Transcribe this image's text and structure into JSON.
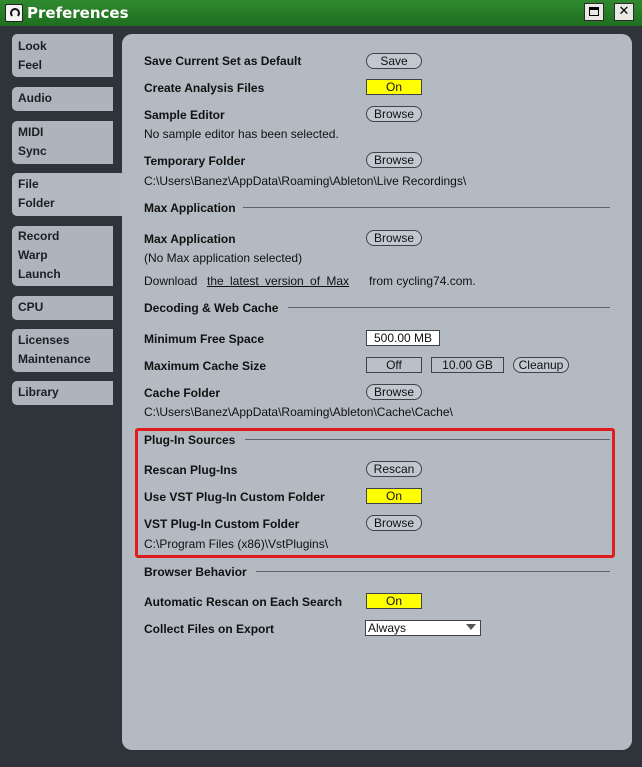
{
  "window": {
    "title": "Preferences"
  },
  "sidebar": {
    "tabs": [
      {
        "lines": [
          "Look",
          "Feel"
        ]
      },
      {
        "lines": [
          "Audio"
        ]
      },
      {
        "lines": [
          "MIDI",
          "Sync"
        ]
      },
      {
        "lines": [
          "File",
          "Folder"
        ],
        "active": true
      },
      {
        "lines": [
          "Record",
          "Warp",
          "Launch"
        ]
      },
      {
        "lines": [
          "CPU"
        ]
      },
      {
        "lines": [
          "Licenses",
          "Maintenance"
        ]
      },
      {
        "lines": [
          "Library"
        ]
      }
    ]
  },
  "panel": {
    "save_current_set": {
      "label": "Save Current Set as Default",
      "button": "Save"
    },
    "create_analysis_files": {
      "label": "Create Analysis Files",
      "value": "On"
    },
    "sample_editor": {
      "label": "Sample Editor",
      "button": "Browse",
      "status": "No sample editor has been selected."
    },
    "temporary_folder": {
      "label": "Temporary Folder",
      "button": "Browse",
      "path": "C:\\Users\\Banez\\AppData\\Roaming\\Ableton\\Live Recordings\\"
    },
    "max_section": "Max Application",
    "max_application": {
      "label": "Max Application",
      "button": "Browse",
      "status": "(No Max application selected)"
    },
    "download_max": {
      "prefix": "Download",
      "link": "the latest version of Max",
      "suffix": "from cycling74.com."
    },
    "cache_section": "Decoding & Web Cache",
    "min_free_space": {
      "label": "Minimum Free Space",
      "value": "500.00 MB"
    },
    "max_cache_size": {
      "label": "Maximum Cache Size",
      "toggle": "Off",
      "value": "10.00 GB",
      "cleanup": "Cleanup"
    },
    "cache_folder": {
      "label": "Cache Folder",
      "button": "Browse",
      "path": "C:\\Users\\Banez\\AppData\\Roaming\\Ableton\\Cache\\Cache\\"
    },
    "plugin_section": "Plug-In Sources",
    "rescan_plugins": {
      "label": "Rescan Plug-Ins",
      "button": "Rescan"
    },
    "use_vst_custom_folder": {
      "label": "Use VST Plug-In Custom Folder",
      "value": "On"
    },
    "vst_custom_folder": {
      "label": "VST Plug-In Custom Folder",
      "button": "Browse",
      "path": "C:\\Program Files (x86)\\VstPlugins\\"
    },
    "browser_section": "Browser Behavior",
    "auto_rescan": {
      "label": "Automatic Rescan on Each Search",
      "value": "On"
    },
    "collect_files": {
      "label": "Collect Files on Export",
      "value": "Always"
    }
  },
  "colors": {
    "titlebar": "#1f6e1f",
    "toggle_on": "#ffff00",
    "highlight": "#e01c1c"
  }
}
